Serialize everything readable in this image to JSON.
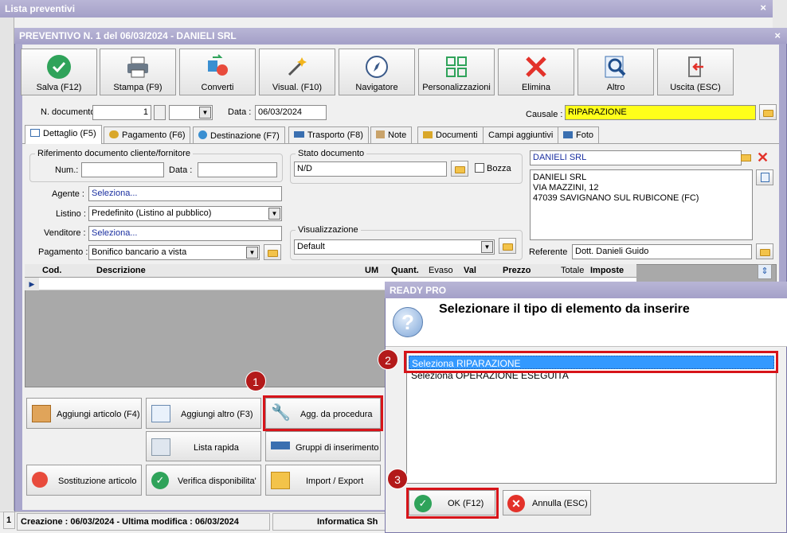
{
  "outer": {
    "title": "Lista preventivi",
    "close": "×"
  },
  "window": {
    "title": "PREVENTIVO N. 1 del 06/03/2024 - DANIELI SRL",
    "close": "×"
  },
  "toolbar": {
    "save": "Salva (F12)",
    "print": "Stampa (F9)",
    "convert": "Converti",
    "view": "Visual. (F10)",
    "navigator": "Navigatore",
    "customize": "Personalizzazioni",
    "delete": "Elimina",
    "other": "Altro",
    "exit": "Uscita (ESC)"
  },
  "header": {
    "doc_number_label": "N. documento :",
    "doc_number": "1",
    "date_label": "Data :",
    "date": "06/03/2024",
    "causale_label": "Causale :",
    "causale": "RIPARAZIONE"
  },
  "tabs": [
    "Dettaglio (F5)",
    "Pagamento (F6)",
    "Destinazione (F7)",
    "Trasporto (F8)",
    "Note",
    "Documenti",
    "Campi aggiuntivi",
    "Foto"
  ],
  "detail": {
    "ref_group": "Riferimento documento cliente/fornitore",
    "num_label": "Num.:",
    "data_label": "Data :",
    "agente_label": "Agente :",
    "agente": "Seleziona...",
    "listino_label": "Listino :",
    "listino": "Predefinito (Listino al pubblico)",
    "venditore_label": "Venditore :",
    "venditore": "Seleziona...",
    "pagamento_label": "Pagamento :",
    "pagamento": "Bonifico bancario a vista",
    "stato_group": "Stato documento",
    "stato": "N/D",
    "bozza": "Bozza",
    "vis_group": "Visualizzazione",
    "vis": "Default",
    "cliente": "DANIELI SRL",
    "address": [
      "DANIELI SRL",
      "VIA MAZZINI, 12",
      "47039 SAVIGNANO SUL RUBICONE (FC)"
    ],
    "referente_label": "Referente",
    "referente": "Dott. Danieli Guido"
  },
  "grid": {
    "cols": [
      "Cod.",
      "Descrizione",
      "UM",
      "Quant.",
      "Evaso",
      "Val",
      "Prezzo",
      "Totale",
      "Imposte"
    ]
  },
  "actions": {
    "add_article": "Aggiungi articolo (F4)",
    "add_other": "Aggiungi altro (F3)",
    "add_procedure": "Agg. da procedura",
    "quick_list": "Lista rapida",
    "groups": "Gruppi di inserimento",
    "substitute": "Sostituzione articolo",
    "availability": "Verifica disponibilita'",
    "import": "Import / Export"
  },
  "status": {
    "created": "Creazione : 06/03/2024 - Ultima modifica : 06/03/2024",
    "company": "Informatica Sh",
    "left": "1"
  },
  "dialog": {
    "title": "READY PRO",
    "message": "Selezionare il tipo di elemento da inserire",
    "options": [
      "Seleziona RIPARAZIONE",
      "Seleziona OPERAZIONE ESEGUITA"
    ],
    "ok": "OK (F12)",
    "cancel": "Annulla (ESC)"
  },
  "markers": [
    "1",
    "2",
    "3"
  ]
}
